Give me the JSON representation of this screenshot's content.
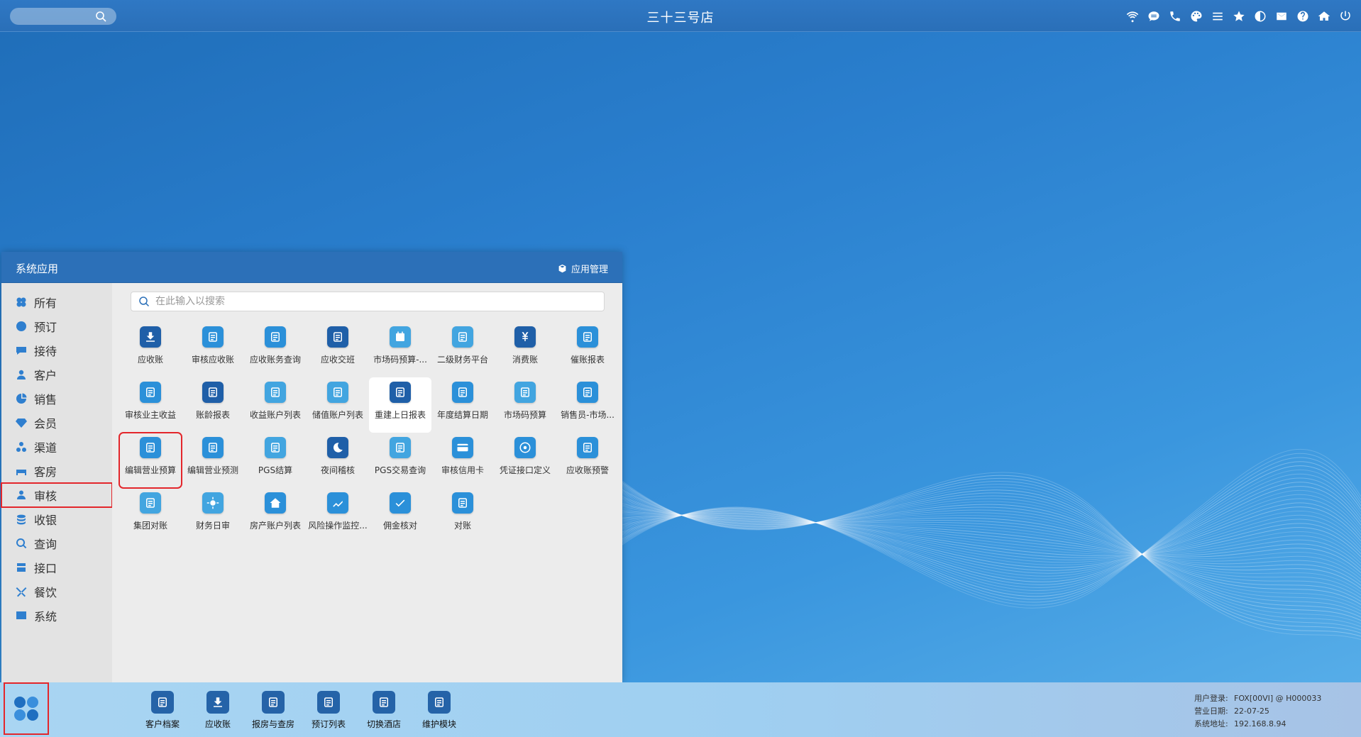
{
  "topbar": {
    "title": "三十三号店",
    "search_placeholder": "",
    "icons": [
      "wifi-icon",
      "chat-icon",
      "phone-icon",
      "palette-icon",
      "menu-icon",
      "star-icon",
      "theme-icon",
      "mail-icon",
      "help-icon",
      "home-icon",
      "power-icon"
    ]
  },
  "app_window": {
    "title": "系统应用",
    "manage_label": "应用管理",
    "search_placeholder": "在此输入以搜索",
    "sidebar": [
      {
        "label": "所有",
        "icon": "apps-icon",
        "color": "#2f7fcf"
      },
      {
        "label": "预订",
        "icon": "reserve-icon",
        "color": "#2f7fcf"
      },
      {
        "label": "接待",
        "icon": "chat-icon",
        "color": "#2f7fcf"
      },
      {
        "label": "客户",
        "icon": "user-icon",
        "color": "#2f7fcf"
      },
      {
        "label": "销售",
        "icon": "pie-icon",
        "color": "#2f7fcf"
      },
      {
        "label": "会员",
        "icon": "diamond-icon",
        "color": "#2f7fcf"
      },
      {
        "label": "渠道",
        "icon": "share-icon",
        "color": "#2f7fcf"
      },
      {
        "label": "客房",
        "icon": "bed-icon",
        "color": "#2f7fcf"
      },
      {
        "label": "审核",
        "icon": "audit-user-icon",
        "color": "#2f7fcf"
      },
      {
        "label": "收银",
        "icon": "coins-icon",
        "color": "#2f7fcf"
      },
      {
        "label": "查询",
        "icon": "search-icon",
        "color": "#2f7fcf"
      },
      {
        "label": "接口",
        "icon": "plug-icon",
        "color": "#2f7fcf"
      },
      {
        "label": "餐饮",
        "icon": "utensils-icon",
        "color": "#2f7fcf"
      },
      {
        "label": "系统",
        "icon": "system-icon",
        "color": "#2f7fcf"
      }
    ],
    "apps": [
      {
        "label": "应收账",
        "icon": "receivable-icon",
        "color": "#1f5fa8"
      },
      {
        "label": "审核应收账",
        "icon": "audit-receivable-icon",
        "color": "#2b90d9"
      },
      {
        "label": "应收账务查询",
        "icon": "query-icon",
        "color": "#2b90d9"
      },
      {
        "label": "应收交班",
        "icon": "shift-icon",
        "color": "#1f5fa8"
      },
      {
        "label": "市场码预算-...",
        "icon": "calendar-icon",
        "color": "#42a5e0"
      },
      {
        "label": "二级财务平台",
        "icon": "database-icon",
        "color": "#42a5e0"
      },
      {
        "label": "消费账",
        "icon": "yen-icon",
        "color": "#1f5fa8"
      },
      {
        "label": "催账报表",
        "icon": "bell-icon",
        "color": "#2b90d9"
      },
      {
        "label": "审核业主收益",
        "icon": "owner-icon",
        "color": "#2b90d9"
      },
      {
        "label": "账龄报表",
        "icon": "chart-icon",
        "color": "#1f5fa8"
      },
      {
        "label": "收益账户列表",
        "icon": "list-icon",
        "color": "#42a5e0"
      },
      {
        "label": "储值账户列表",
        "icon": "card-list-icon",
        "color": "#42a5e0"
      },
      {
        "label": "重建上日报表",
        "icon": "rebuild-icon",
        "color": "#1f5fa8"
      },
      {
        "label": "年度结算日期",
        "icon": "calendar-grid-icon",
        "color": "#2b90d9"
      },
      {
        "label": "市场码预算",
        "icon": "budget-icon",
        "color": "#42a5e0"
      },
      {
        "label": "销售员-市场...",
        "icon": "salesman-icon",
        "color": "#2b90d9"
      },
      {
        "label": "编辑营业预算",
        "icon": "edit-budget-icon",
        "color": "#2b90d9"
      },
      {
        "label": "编辑营业预测",
        "icon": "edit-forecast-icon",
        "color": "#2b90d9"
      },
      {
        "label": "PGS结算",
        "icon": "pgs-icon",
        "color": "#42a5e0"
      },
      {
        "label": "夜间稽核",
        "icon": "moon-icon",
        "color": "#1f5fa8"
      },
      {
        "label": "PGS交易查询",
        "icon": "pgs-query-icon",
        "color": "#42a5e0"
      },
      {
        "label": "审核信用卡",
        "icon": "credit-card-icon",
        "color": "#2b90d9"
      },
      {
        "label": "凭证接口定义",
        "icon": "target-icon",
        "color": "#2b90d9"
      },
      {
        "label": "应收账预警",
        "icon": "alert-icon",
        "color": "#2b90d9"
      },
      {
        "label": "集团对账",
        "icon": "building-icon",
        "color": "#42a5e0"
      },
      {
        "label": "财务日审",
        "icon": "sun-icon",
        "color": "#42a5e0"
      },
      {
        "label": "房产账户列表",
        "icon": "house-icon",
        "color": "#2b90d9"
      },
      {
        "label": "风险操作监控...",
        "icon": "trend-icon",
        "color": "#2b90d9"
      },
      {
        "label": "佣金核对",
        "icon": "check-icon",
        "color": "#2b90d9"
      },
      {
        "label": "对账",
        "icon": "reconcile-icon",
        "color": "#2b90d9"
      }
    ]
  },
  "taskbar": {
    "dock": [
      {
        "label": "客户档案",
        "icon": "profile-icon"
      },
      {
        "label": "应收账",
        "icon": "receivable-icon"
      },
      {
        "label": "报房与查房",
        "icon": "house-search-icon"
      },
      {
        "label": "预订列表",
        "icon": "reserve-list-icon"
      },
      {
        "label": "切换酒店",
        "icon": "switch-icon"
      },
      {
        "label": "维护模块",
        "icon": "wrench-icon"
      }
    ],
    "sysinfo": {
      "user_label": "用户登录:",
      "user_value": "FOX[00VI] @ H000033",
      "date_label": "营业日期:",
      "date_value": "22-07-25",
      "addr_label": "系统地址:",
      "addr_value": "192.168.8.94"
    }
  }
}
